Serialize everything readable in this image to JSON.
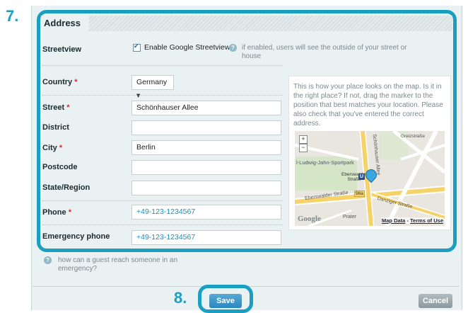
{
  "steps": {
    "seven": "7.",
    "eight": "8."
  },
  "section": {
    "title": "Address"
  },
  "streetview": {
    "label": "Streetview",
    "checkbox_label": "Enable Google Streetview",
    "checked": true,
    "hint": "if enabled, users will see the outside of your street or house"
  },
  "fields": {
    "country": {
      "label": "Country",
      "value": "Germany ▾"
    },
    "street": {
      "label": "Street",
      "value": "Schönhauser Allee"
    },
    "district": {
      "label": "District",
      "value": ""
    },
    "city": {
      "label": "City",
      "value": "Berlin"
    },
    "postcode": {
      "label": "Postcode",
      "value": ""
    },
    "state": {
      "label": "State/Region",
      "value": ""
    },
    "phone": {
      "label": "Phone",
      "value": "+49-123-1234567"
    },
    "emergency": {
      "label": "Emergency phone",
      "value": "+49-123-1234567",
      "hint": "how can a guest reach someone in an emergency?"
    }
  },
  "required_mark": "*",
  "map": {
    "description": "This is how your place looks on the map. Is it in the right place? If not, drag the marker to the position that best matches your location. Please also check that you've entered the correct address.",
    "zoom_in": "+",
    "zoom_out": "−",
    "streets": {
      "sportpark": "l-Ludwig-Jahn-Sportpark",
      "eberswalder_top": "Eberswalder",
      "strasse_top": "Straße",
      "eberswalder_strasse": "Eberswalder Straße",
      "danziger": "Danziger Straße",
      "schoenhauser": "Schönhauser Allee",
      "greifswalder": "Greizstraße",
      "prater": "Prater",
      "badge": "96a",
      "ubahn": "U"
    },
    "google_logo": "Google",
    "map_data_link": "Map Data",
    "dash": " - ",
    "terms_link": "Terms of Use"
  },
  "buttons": {
    "save": "Save",
    "cancel": "Cancel"
  },
  "colors": {
    "accent": "#1a9fc1",
    "required": "#d6272b",
    "map_marker": "#3aa6dd"
  }
}
